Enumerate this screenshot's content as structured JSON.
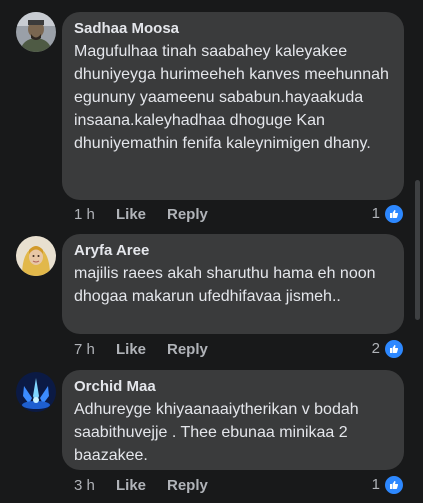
{
  "comments": [
    {
      "name": "Sadhaa Moosa",
      "text": "Magufulhaa tinah saabahey kaleyakee dhuniyeyga hurimeeheh kanves meehunnah egununy yaameenu sababun.hayaakuda insaana.kaleyhadhaa dhoguge Kan dhuniyemathin fenifa kaleynimigen dhany.",
      "time": "1 h",
      "like_label": "Like",
      "reply_label": "Reply",
      "reaction_count": "1",
      "reaction_icon": "like-icon",
      "avatar_icon": "avatar-man-photo"
    },
    {
      "name": "Aryfa Aree",
      "text": "majilis raees akah sharuthu hama eh noon dhogaa makarun ufedhifavaa jismeh..",
      "time": "7 h",
      "like_label": "Like",
      "reply_label": "Reply",
      "reaction_count": "2",
      "reaction_icon": "like-icon",
      "avatar_icon": "avatar-woman-photo"
    },
    {
      "name": "Orchid Maa",
      "text": "Adhureyge khiyaanaaiytherikan v bodah saabithuvejje . Thee ebunaa minikaa 2 baazakee.",
      "time": "3 h",
      "like_label": "Like",
      "reply_label": "Reply",
      "reaction_count": "1",
      "reaction_icon": "like-icon",
      "avatar_icon": "avatar-blue-decorative"
    }
  ],
  "colors": {
    "background": "#18191a",
    "bubble": "#3a3b3c",
    "text": "#e4e6eb",
    "secondary": "#b0b3b8",
    "like_blue": "#2d88ff"
  }
}
